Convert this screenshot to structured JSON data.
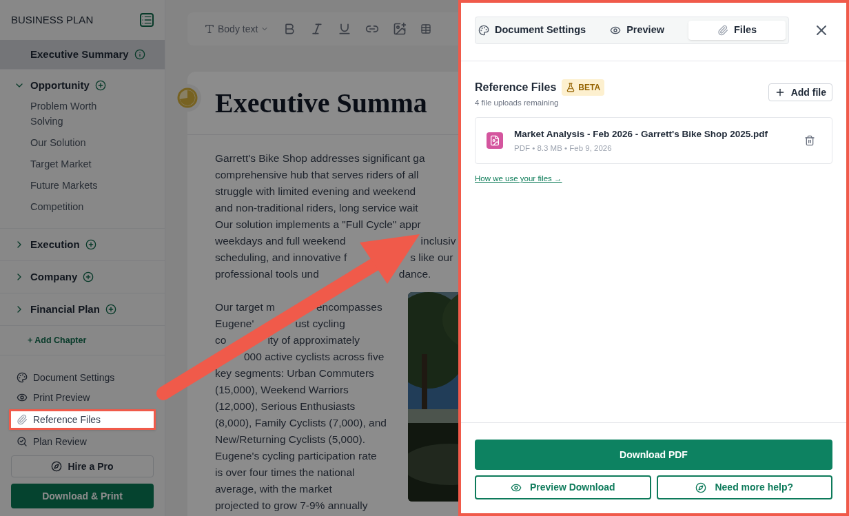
{
  "sidebar": {
    "title": "BUSINESS PLAN",
    "chapters": [
      {
        "kind": "summary",
        "title": "Executive Summary",
        "selected": true
      },
      {
        "kind": "chapter",
        "title": "Opportunity",
        "expanded": true,
        "children": [
          {
            "label": "Problem Worth Solving"
          },
          {
            "label": "Our Solution"
          },
          {
            "label": "Target Market"
          },
          {
            "label": "Future Markets"
          },
          {
            "label": "Competition"
          }
        ]
      },
      {
        "kind": "chapter",
        "title": "Execution",
        "expanded": false
      },
      {
        "kind": "chapter",
        "title": "Company",
        "expanded": false
      },
      {
        "kind": "chapter",
        "title": "Financial Plan",
        "expanded": false
      }
    ],
    "add_chapter": "+ Add Chapter",
    "tools": [
      {
        "kind": "settings",
        "label": "Document Settings",
        "highlighted": false
      },
      {
        "kind": "preview",
        "label": "Print Preview",
        "highlighted": false
      },
      {
        "kind": "files",
        "label": "Reference Files",
        "highlighted": true
      },
      {
        "kind": "review",
        "label": "Plan Review",
        "highlighted": false
      }
    ],
    "hire_button": "Hire a Pro",
    "download_button": "Download & Print"
  },
  "toolbar": {
    "text_style": "Body text"
  },
  "document": {
    "title": "Executive Summa",
    "paragraph_1": [
      [
        "Garrett's Bike Shop addresses significant ga"
      ],
      [
        "comprehensive hub that serves riders of all"
      ],
      [
        "struggle with limited evening and weekend"
      ],
      [
        "and non-traditional riders, long service wait"
      ],
      [
        "Our solution implements a \"Full Cycle\" appr"
      ],
      [
        "weekdays and full weekend",
        "inclusiv"
      ],
      [
        "scheduling, and innovative f",
        "s like our"
      ],
      [
        "professional tools und",
        "dance."
      ]
    ],
    "paragraph_2": [
      [
        "Our target m",
        "encompasses"
      ],
      [
        "Eugene'",
        "ust cycling"
      ],
      [
        "co",
        "ity of approximately"
      ],
      [
        "000 active cyclists across five"
      ],
      [
        "key segments: Urban Commuters"
      ],
      [
        "(15,000), Weekend Warriors"
      ],
      [
        "(12,000), Serious Enthusiasts"
      ],
      [
        "(8,000), Family Cyclists (7,000), and"
      ],
      [
        "New/Returning Cyclists (5,000)."
      ],
      [
        "Eugene's cycling participation rate"
      ],
      [
        "is over four times the national"
      ],
      [
        "average, with the market"
      ],
      [
        "projected to grow 7-9% annually"
      ]
    ]
  },
  "panel": {
    "tabs": [
      {
        "kind": "settings",
        "label": "Document Settings",
        "selected": false
      },
      {
        "kind": "preview",
        "label": "Preview",
        "selected": false
      },
      {
        "kind": "files",
        "label": "Files",
        "selected": true
      }
    ],
    "heading": "Reference Files",
    "badge": "BETA",
    "subtitle": "4 file uploads remaining",
    "add_button": "Add file",
    "files": [
      {
        "name": "Market Analysis - Feb 2026 - Garrett's Bike Shop 2025.pdf",
        "meta": "PDF • 8.3 MB • Feb 9, 2026"
      }
    ],
    "link": "How we use your files →",
    "download_button": "Download PDF",
    "preview_button": "Preview Download",
    "help_button": "Need more help?"
  }
}
